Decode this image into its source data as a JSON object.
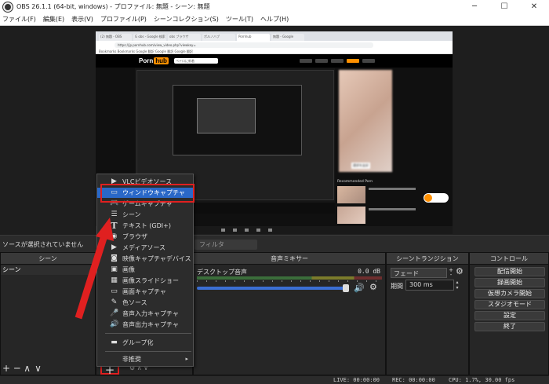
{
  "window": {
    "title": "OBS 26.1.1 (64-bit, windows) - プロファイル: 無題 - シーン: 無題",
    "minimize": "─",
    "maximize": "☐",
    "close": "✕"
  },
  "menubar": [
    "ファイル(F)",
    "編集(E)",
    "表示(V)",
    "プロファイル(P)",
    "シーンコレクション(S)",
    "ツール(T)",
    "ヘルプ(H)"
  ],
  "preview": {
    "browser_tabs": [
      "(2) 無題 - OBS",
      "G obs - Google 検索",
      "obs ブラウザ",
      "ポルノハブ",
      "Pornhub",
      "無題 - Google"
    ],
    "url": "https://jp.pornhub.com/view_video.php?viewkey=",
    "bookmarks": "Bookmarks  Bookmarks  Google 翻訳  Google 翻訳  Google 翻訳",
    "logo_porn": "Porn",
    "logo_hub": "hub",
    "search_placeholder": "ペドロに新着",
    "thumb_caption": "請求を友好",
    "recommended_label": "Recommended Porn"
  },
  "sources_label": "ソースが選択されていません",
  "filter_button": "フィルタ",
  "scenes": {
    "title": "シーン",
    "items": [
      "シーン"
    ],
    "toolbar": [
      "+",
      "─",
      "∧",
      "∨"
    ]
  },
  "sources": {
    "add_button": "+",
    "toolbar_misc": "⚙ ∧ ∨"
  },
  "context_menu": {
    "items": [
      {
        "label": "VLCビデオソース",
        "icon": "▶"
      },
      {
        "label": "ウィンドウキャプチャ",
        "icon": "▭"
      },
      {
        "label": "ゲームキャプチャ",
        "icon": "🎮"
      },
      {
        "label": "シーン",
        "icon": "☰"
      },
      {
        "label": "テキスト (GDI+)",
        "icon": "T"
      },
      {
        "label": "ブラウザ",
        "icon": "◉"
      },
      {
        "label": "メディアソース",
        "icon": "▶"
      },
      {
        "label": "映像キャプチャデバイス",
        "icon": "◙"
      },
      {
        "label": "画像",
        "icon": "▣"
      },
      {
        "label": "画像スライドショー",
        "icon": "▦"
      },
      {
        "label": "画面キャプチャ",
        "icon": "▭"
      },
      {
        "label": "色ソース",
        "icon": "✎"
      },
      {
        "label": "音声入力キャプチャ",
        "icon": "🎤"
      },
      {
        "label": "音声出力キャプチャ",
        "icon": "🔊"
      },
      {
        "label": "グループ化",
        "icon": "▬"
      },
      {
        "label": "非推奨",
        "icon": ""
      }
    ],
    "submenu_arrow": "▸"
  },
  "mixer": {
    "title": "音声ミキサー",
    "channel": "デスクトップ音声",
    "db": "0.0 dB",
    "speaker_icon": "🔊",
    "gear_icon": "⚙"
  },
  "transitions": {
    "title": "シーントランジション",
    "selected": "フェード",
    "plus": "+",
    "minus": "-",
    "duration_label": "期間",
    "duration_value": "300 ms",
    "gear_icon": "⚙",
    "spin_up": "▴",
    "spin_down": "▾"
  },
  "controls": {
    "title": "コントロール",
    "buttons": [
      "配信開始",
      "録画開始",
      "仮想カメラ開始",
      "スタジオモード",
      "設定",
      "終了"
    ]
  },
  "status": {
    "live": "LIVE: 00:00:00",
    "rec": "REC: 00:00:00",
    "cpu": "CPU: 1.7%, 30.00 fps"
  },
  "colors": {
    "accent_selection": "#2a68c8",
    "annotation_red": "#e02020",
    "volume_bar": "#3b6fd4"
  }
}
